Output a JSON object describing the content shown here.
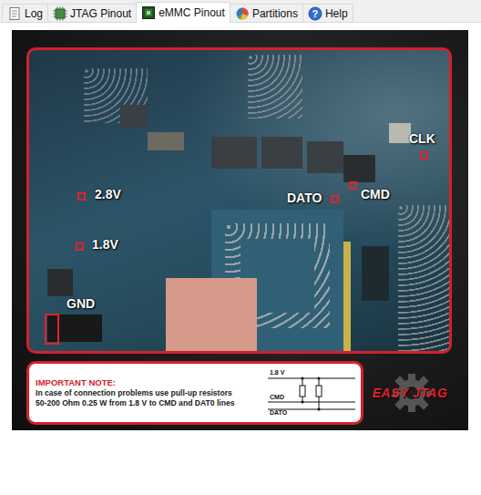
{
  "tabs": [
    {
      "label": "Log",
      "selected": false,
      "icon": "log"
    },
    {
      "label": "JTAG Pinout",
      "selected": false,
      "icon": "chip"
    },
    {
      "label": "eMMC Pinout",
      "selected": true,
      "icon": "emmc"
    },
    {
      "label": "Partitions",
      "selected": false,
      "icon": "pie"
    },
    {
      "label": "Help",
      "selected": false,
      "icon": "help",
      "icon_glyph": "?"
    }
  ],
  "pinout": {
    "pins": [
      {
        "label": "2.8V"
      },
      {
        "label": "1.8V"
      },
      {
        "label": "GND"
      },
      {
        "label": "DATO"
      },
      {
        "label": "CMD"
      },
      {
        "label": "CLK"
      }
    ]
  },
  "note": {
    "title": "IMPORTANT NOTE:",
    "lines": [
      "In case of connection problems use pull-up resistors",
      "50-200 Ohm 0.25 W from 1.8 V to CMD and DAT0 lines"
    ]
  },
  "schematic": {
    "labels": [
      "1.8 V",
      "CMD",
      "DATO"
    ]
  },
  "logo": {
    "text": "EASY JTAG"
  }
}
